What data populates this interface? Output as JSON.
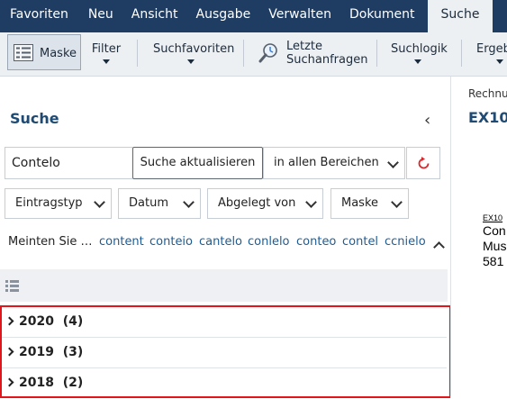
{
  "menu": {
    "tabs": [
      "Favoriten",
      "Neu",
      "Ansicht",
      "Ausgabe",
      "Verwalten",
      "Dokument",
      "Suche"
    ],
    "active": "Suche"
  },
  "ribbon": {
    "maske": "Maske",
    "filter": "Filter",
    "favoriten": "Suchfavoriten",
    "letzte_line1": "Letzte",
    "letzte_line2": "Suchanfragen",
    "logik": "Suchlogik",
    "ergebnis": "Ergeb"
  },
  "panel": {
    "title": "Suche",
    "collapse_icon": "chevron-left-icon"
  },
  "search": {
    "query": "Contelo",
    "update_label": "Suche aktualisieren",
    "area": "in allen Bereichen",
    "reset_icon": "refresh-icon",
    "reset_color": "#d9282e"
  },
  "filters": [
    "Eintragstyp",
    "Datum",
    "Abgelegt von",
    "Maske"
  ],
  "did_you_mean": {
    "label": "Meinten Sie …",
    "suggestions": [
      "content",
      "conteio",
      "cantelo",
      "conlelo",
      "conteo",
      "contel",
      "ccnielo"
    ]
  },
  "results": {
    "highlight_color": "#e3151a",
    "groups": [
      {
        "year": "2020",
        "count": "(4)"
      },
      {
        "year": "2019",
        "count": "(3)"
      },
      {
        "year": "2018",
        "count": "(2)"
      }
    ]
  },
  "preview": {
    "label": "Rechnu",
    "title": "EX10",
    "doc_ref": "EX10",
    "doc_lines": [
      "Con",
      "Mus",
      "581"
    ]
  }
}
